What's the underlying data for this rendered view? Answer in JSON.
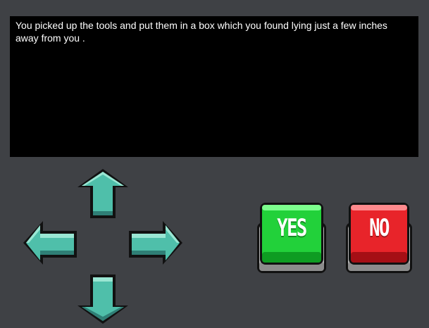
{
  "message": {
    "text": "You picked up the tools and put them in a box which you found lying just a few inches away from you ."
  },
  "controls": {
    "up_icon": "arrow-up-icon",
    "down_icon": "arrow-down-icon",
    "left_icon": "arrow-left-icon",
    "right_icon": "arrow-right-icon"
  },
  "buttons": {
    "yes_label": "YES",
    "no_label": "NO"
  },
  "colors": {
    "background": "#3f4145",
    "panel": "#000000",
    "arrow": "#4fbfaa",
    "yes": "#22d13a",
    "no": "#e8242a"
  }
}
